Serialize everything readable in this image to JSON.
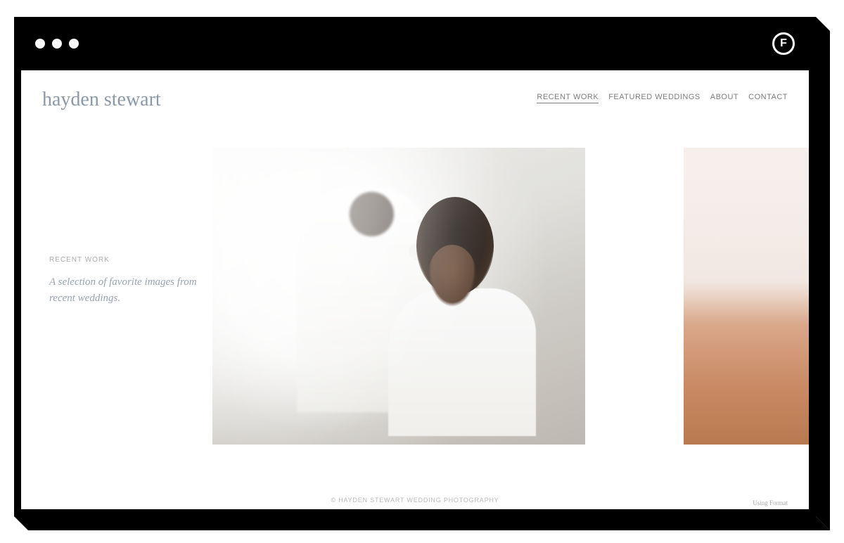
{
  "logo": "hayden stewart",
  "nav": {
    "items": [
      {
        "label": "RECENT WORK",
        "active": true
      },
      {
        "label": "FEATURED WEDDINGS",
        "active": false
      },
      {
        "label": "ABOUT",
        "active": false
      },
      {
        "label": "CONTACT",
        "active": false
      }
    ]
  },
  "section": {
    "title": "RECENT WORK",
    "desc": "A selection of favorite images from recent weddings."
  },
  "footer": {
    "copyright": "© HAYDEN STEWART WEDDING PHOTOGRAPHY",
    "credit": "Using Format"
  },
  "frame": {
    "brand_letter": "F"
  }
}
